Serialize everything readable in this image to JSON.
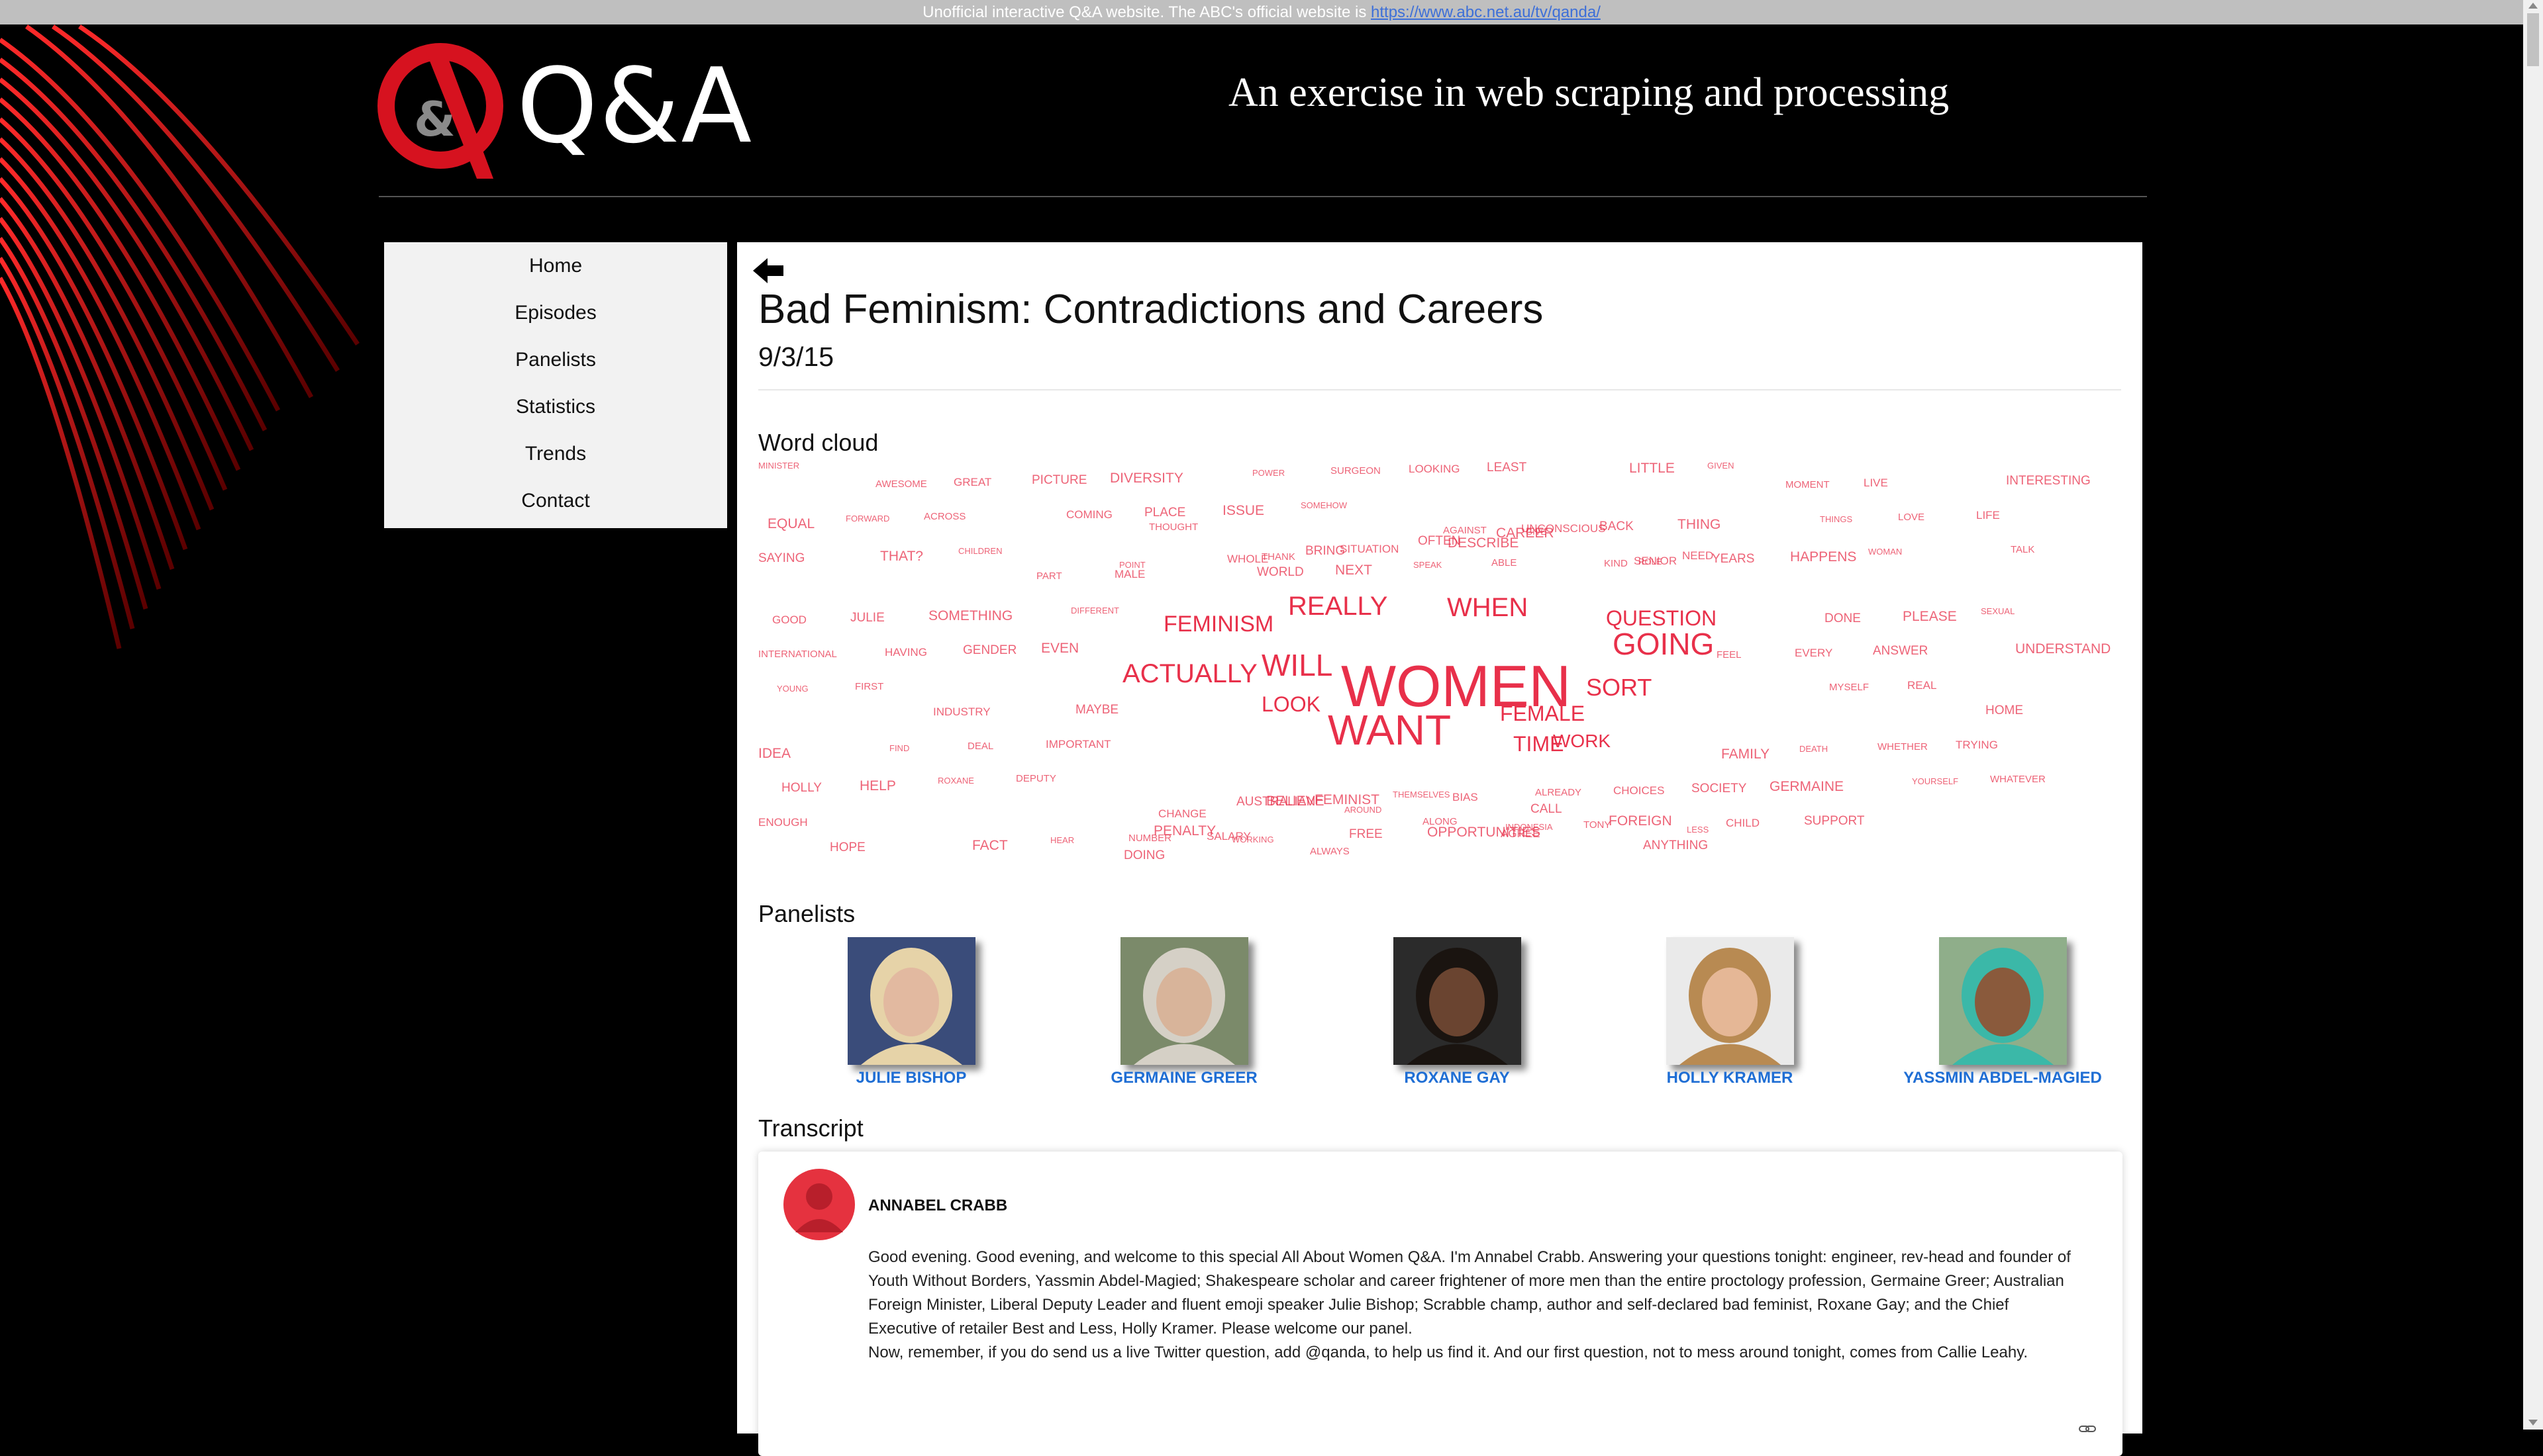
{
  "topbar": {
    "notice": "Unofficial interactive Q&A website. The ABC's official website is ",
    "link": "https://www.abc.net.au/tv/qanda/"
  },
  "header": {
    "logo_text": "Q&A",
    "tagline": "An exercise in web scraping and processing"
  },
  "nav": {
    "items": [
      "Home",
      "Episodes",
      "Panelists",
      "Statistics",
      "Trends",
      "Contact"
    ]
  },
  "episode": {
    "title": "Bad Feminism: Contradictions and Careers",
    "date": "9/3/15"
  },
  "sections": {
    "word_cloud": "Word cloud",
    "panelists": "Panelists",
    "transcript": "Transcript"
  },
  "word_cloud": {
    "words": [
      {
        "t": "women",
        "s": "xl"
      },
      {
        "t": "want",
        "s": "xl2"
      },
      {
        "t": "going",
        "s": "l"
      },
      {
        "t": "will",
        "s": "l"
      },
      {
        "t": "actually",
        "s": "l"
      },
      {
        "t": "really",
        "s": "m"
      },
      {
        "t": "when",
        "s": "m"
      },
      {
        "t": "sort",
        "s": "m"
      },
      {
        "t": "question",
        "s": "m"
      },
      {
        "t": "feminism",
        "s": "m"
      },
      {
        "t": "look",
        "s": "m"
      },
      {
        "t": "female",
        "s": "m"
      },
      {
        "t": "time",
        "s": "m"
      },
      {
        "t": "work",
        "s": "m"
      }
    ],
    "small_words": [
      "minister",
      "awesome",
      "great",
      "picture",
      "diversity",
      "power",
      "surgeon",
      "looking",
      "least",
      "little",
      "given",
      "moment",
      "live",
      "interesting",
      "equal",
      "forward",
      "across",
      "coming",
      "place",
      "issue",
      "somehow",
      "against",
      "unconscious",
      "back",
      "thing",
      "things",
      "love",
      "life",
      "saying",
      "that?",
      "children",
      "part",
      "male",
      "world",
      "next",
      "speak",
      "able",
      "senior",
      "years",
      "happens",
      "woman",
      "talk",
      "good",
      "julie",
      "something",
      "different",
      "thought",
      "whole",
      "bring",
      "describe",
      "give",
      "kind",
      "need",
      "done",
      "please",
      "sexual",
      "international",
      "having",
      "gender",
      "even",
      "point",
      "thank",
      "situation",
      "often",
      "career",
      "role",
      "feel",
      "every",
      "answer",
      "understand",
      "young",
      "first",
      "industry",
      "maybe",
      "penalty",
      "working",
      "always",
      "bias",
      "call",
      "foreign",
      "less",
      "myself",
      "real",
      "home",
      "idea",
      "find",
      "deal",
      "important",
      "doing",
      "believe",
      "around",
      "along",
      "agree",
      "anything",
      "family",
      "death",
      "whether",
      "trying",
      "holly",
      "help",
      "roxane",
      "deputy",
      "change",
      "australian",
      "feminist",
      "themselves",
      "already",
      "choices",
      "society",
      "germaine",
      "yourself",
      "whatever",
      "enough",
      "hope",
      "fact",
      "hear",
      "number",
      "salary",
      "free",
      "opportunities",
      "indonesia",
      "tony",
      "child",
      "support"
    ],
    "color": "#e8304a"
  },
  "panelists": [
    {
      "name": "JULIE BISHOP",
      "skin": "#e2b9a0",
      "hair": "#e6d3a8",
      "bg": "#3a4c7a"
    },
    {
      "name": "GERMAINE GREER",
      "skin": "#d8b49a",
      "hair": "#d5d0c6",
      "bg": "#7b8a6a"
    },
    {
      "name": "ROXANE GAY",
      "skin": "#6a4430",
      "hair": "#1a1410",
      "bg": "#2b2b2b"
    },
    {
      "name": "HOLLY KRAMER",
      "skin": "#e5b796",
      "hair": "#b88a52",
      "bg": "#eaeaea"
    },
    {
      "name": "YASSMIN ABDEL-MAGIED",
      "skin": "#8a5a3c",
      "hair": "#3bb8a8",
      "bg": "#8fae8a"
    }
  ],
  "transcript": {
    "speaker": "ANNABEL CRABB",
    "paragraph1": "Good evening. Good evening, and welcome to this special All About Women Q&A. I'm Annabel Crabb. Answering your questions tonight: engineer, rev-head and founder of Youth Without Borders, Yassmin Abdel-Magied; Shakespeare scholar and career frightener of more men than the entire proctology profession, Germaine Greer; Australian Foreign Minister, Liberal Deputy Leader and fluent emoji speaker Julie Bishop; Scrabble champ, author and self-declared bad feminist, Roxane Gay; and the Chief Executive of retailer Best and Less, Holly Kramer. Please welcome our panel.",
    "paragraph2": "Now, remember, if you do send us a live Twitter question, add @qanda, to help us find it. And our first question, not to mess around tonight, comes from Callie Leahy."
  }
}
